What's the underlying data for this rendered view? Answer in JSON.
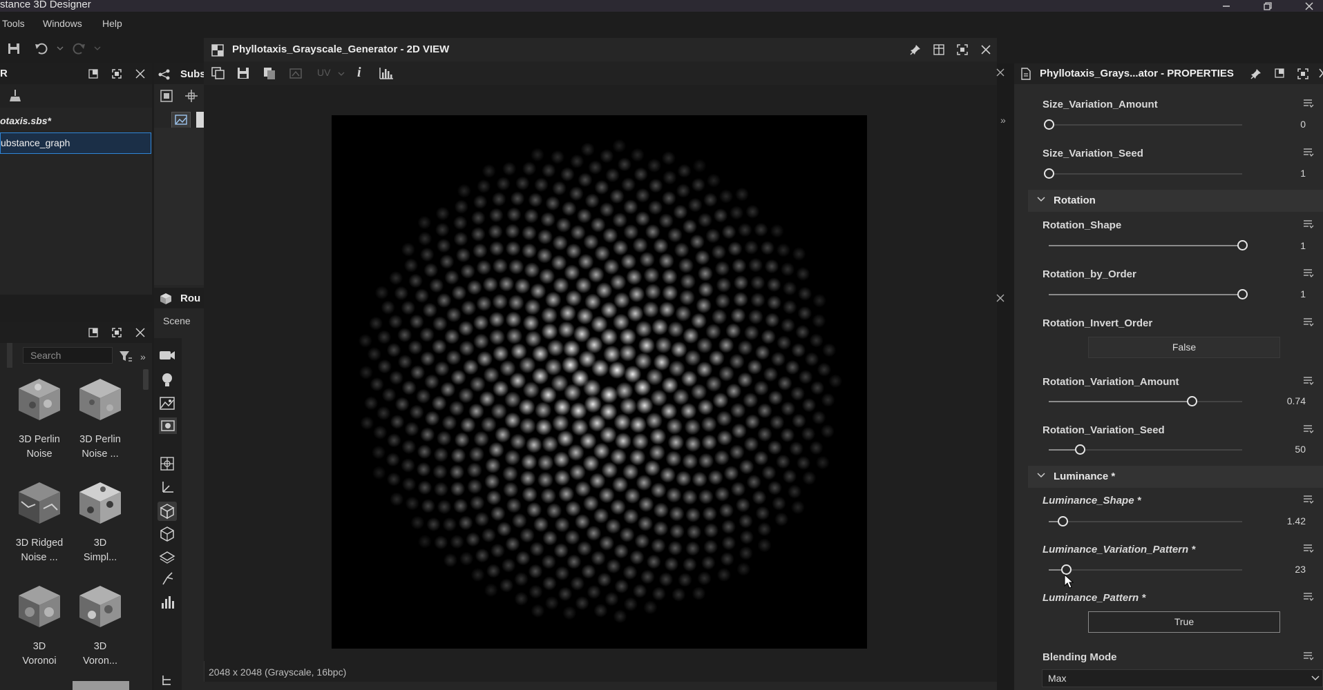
{
  "app": {
    "title": "stance 3D Designer"
  },
  "menu": {
    "items": [
      "Tools",
      "Windows",
      "Help"
    ]
  },
  "explorer": {
    "title": "R",
    "file_name": "otaxis.sbs*",
    "graph_name": "ubstance_graph"
  },
  "graph_panel": {
    "title": "Subs"
  },
  "scene_panel": {
    "title": "Rou",
    "tab": "Scene"
  },
  "library": {
    "search_placeholder": "Search",
    "items": [
      {
        "label": "3D Perlin\nNoise"
      },
      {
        "label": "3D Perlin\nNoise ..."
      },
      {
        "label": "3D Ridged\nNoise ..."
      },
      {
        "label": "3D\nSimpl..."
      },
      {
        "label": "3D\nVoronoi"
      },
      {
        "label": "3D\nVoron..."
      }
    ]
  },
  "view2d": {
    "title": "Phyllotaxis_Grayscale_Generator - 2D VIEW",
    "uv_label": "UV",
    "info_label": "i",
    "status": "2048 x 2048 (Grayscale, 16bpc)"
  },
  "properties": {
    "title": "Phyllotaxis_Grays...ator - PROPERTIES",
    "params": [
      {
        "label": "Size_Variation_Amount",
        "value": "0",
        "fraction": 0.0
      },
      {
        "label": "Size_Variation_Seed",
        "value": "1",
        "fraction": 0.0
      }
    ],
    "rotation": {
      "section": "Rotation",
      "shape": {
        "label": "Rotation_Shape",
        "value": "1",
        "fraction": 1.0
      },
      "by_order": {
        "label": "Rotation_by_Order",
        "value": "1",
        "fraction": 1.0
      },
      "invert_order": {
        "label": "Rotation_Invert_Order",
        "value": "False"
      },
      "variation_amount": {
        "label": "Rotation_Variation_Amount",
        "value": "0.74",
        "fraction": 0.74
      },
      "variation_seed": {
        "label": "Rotation_Variation_Seed",
        "value": "50",
        "fraction": 0.16
      }
    },
    "luminance": {
      "section": "Luminance *",
      "shape": {
        "label": "Luminance_Shape *",
        "value": "1.42",
        "fraction": 0.07
      },
      "variation_pattern": {
        "label": "Luminance_Variation_Pattern *",
        "value": "23",
        "fraction": 0.09
      },
      "pattern": {
        "label": "Luminance_Pattern *",
        "value": "True"
      }
    },
    "blending": {
      "label": "Blending Mode",
      "value": "Max"
    }
  },
  "colors": {
    "selection": "#2f86d8",
    "panel": "#2a2a2a",
    "accent_text": "#ececec"
  }
}
